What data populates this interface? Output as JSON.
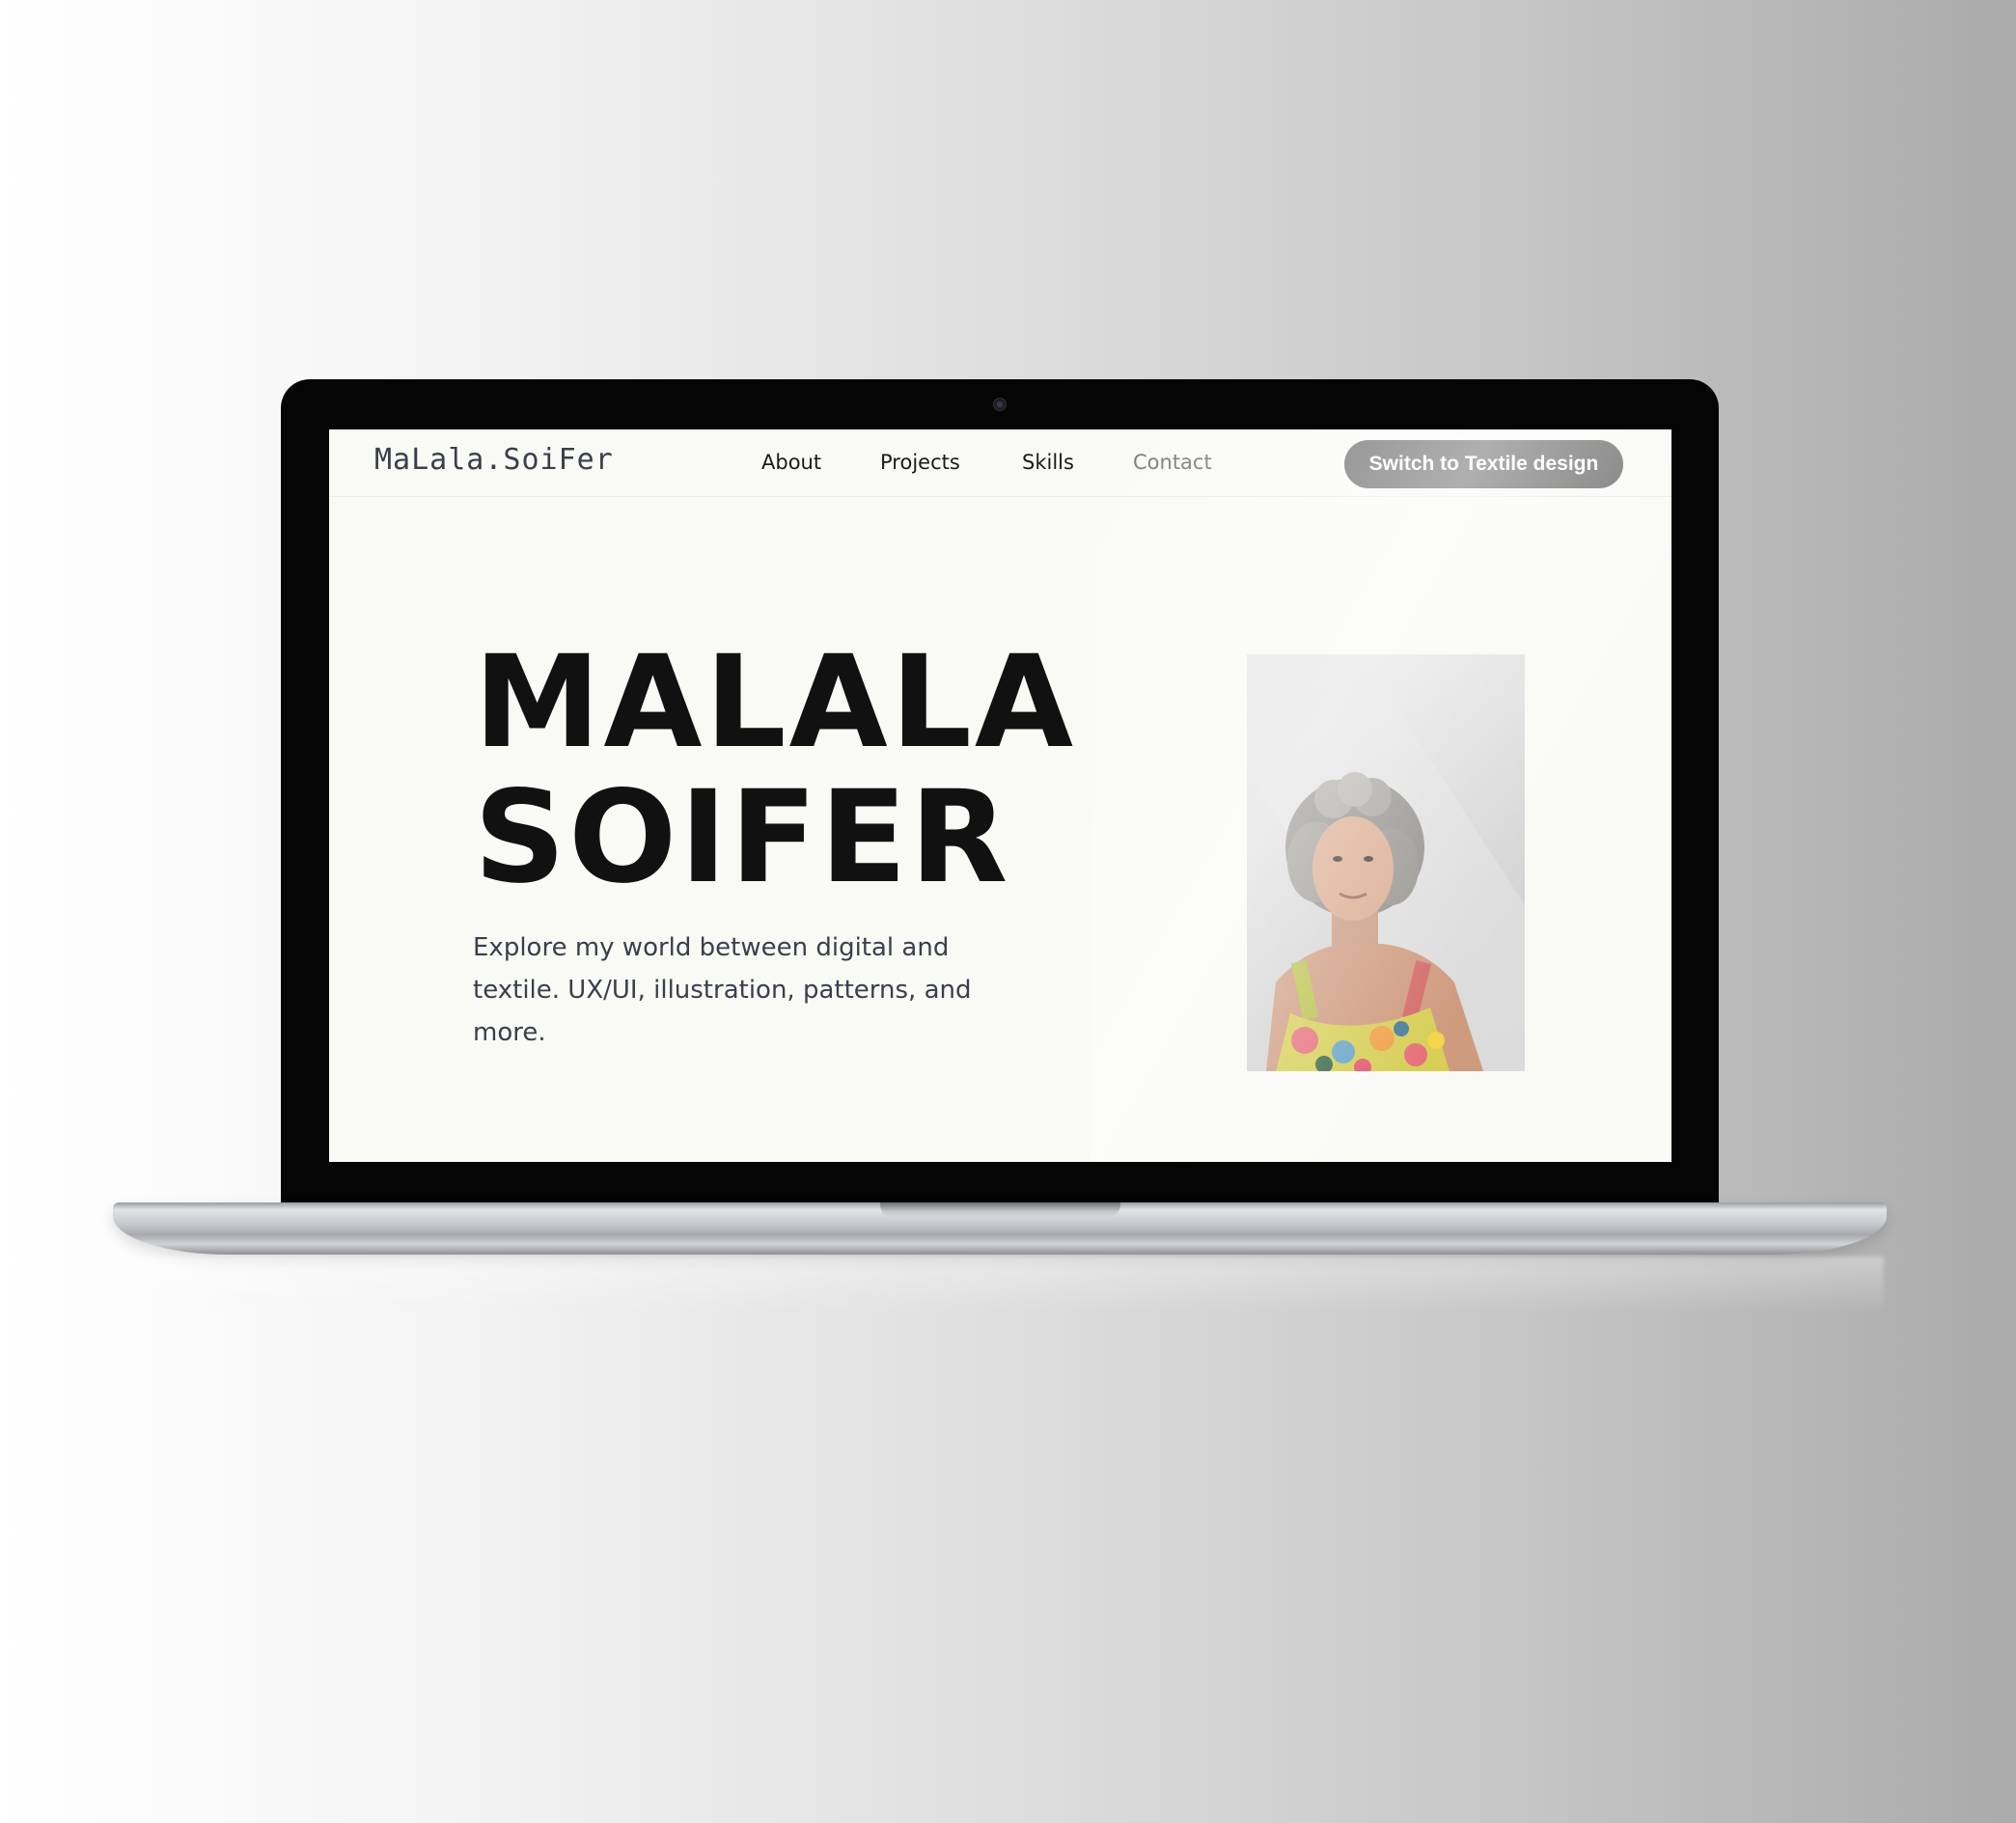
{
  "header": {
    "logo": "MaLala.SoiFer",
    "nav": [
      "About",
      "Projects",
      "Skills",
      "Contact"
    ],
    "switch_button": "Switch to Textile design"
  },
  "hero": {
    "title_line1": "MALALA",
    "title_line2": "SOIFER",
    "tagline": "Explore my world between digital and textile. UX/UI, illustration, patterns, and more."
  },
  "portrait": {
    "icon": "portrait-photo"
  },
  "colors": {
    "page_bg": "#f9f9f6",
    "button_bg": "#6e6e6e",
    "text_dark": "#111111",
    "nav_muted": "#777777"
  }
}
